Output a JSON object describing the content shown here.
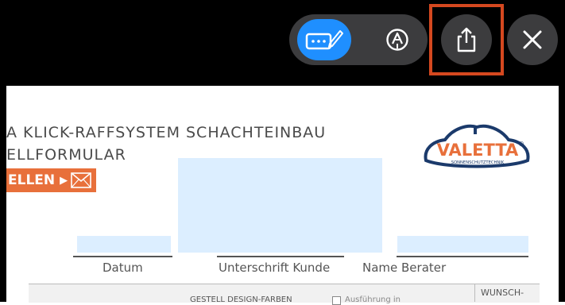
{
  "toolbar": {
    "markup_icon": "markup-keyboard-pen-icon",
    "pen_icon": "pen-circle-icon",
    "share_icon": "share-icon",
    "close_icon": "close-icon",
    "accent_color": "#1f8fff",
    "highlight_color": "#d5481f"
  },
  "document": {
    "title_line1": "A KLICK-RAFFSYSTEM SCHACHTEINBAU",
    "title_line2": "ELLFORMULAR",
    "order_button_label": "ELLEN",
    "order_button_arrow": "▶",
    "mail_icon": "envelope-icon",
    "logo_text": "VALETTA",
    "logo_registered": "®",
    "logo_tagline": "SONNENSCHUTZTECHNIK",
    "signature_fields": {
      "date_label": "Datum",
      "customer_signature_label": "Unterschrift Kunde",
      "advisor_name_label": "Name Berater"
    },
    "table_headers": {
      "frame_colors": "GESTELL DESIGN-FARBEN",
      "execution_checkbox_label": "Ausführung in",
      "wish": "WUNSCH-"
    },
    "field_color": "#dceeff",
    "brand_orange": "#e8703b",
    "brand_navy": "#1b3a6b"
  }
}
